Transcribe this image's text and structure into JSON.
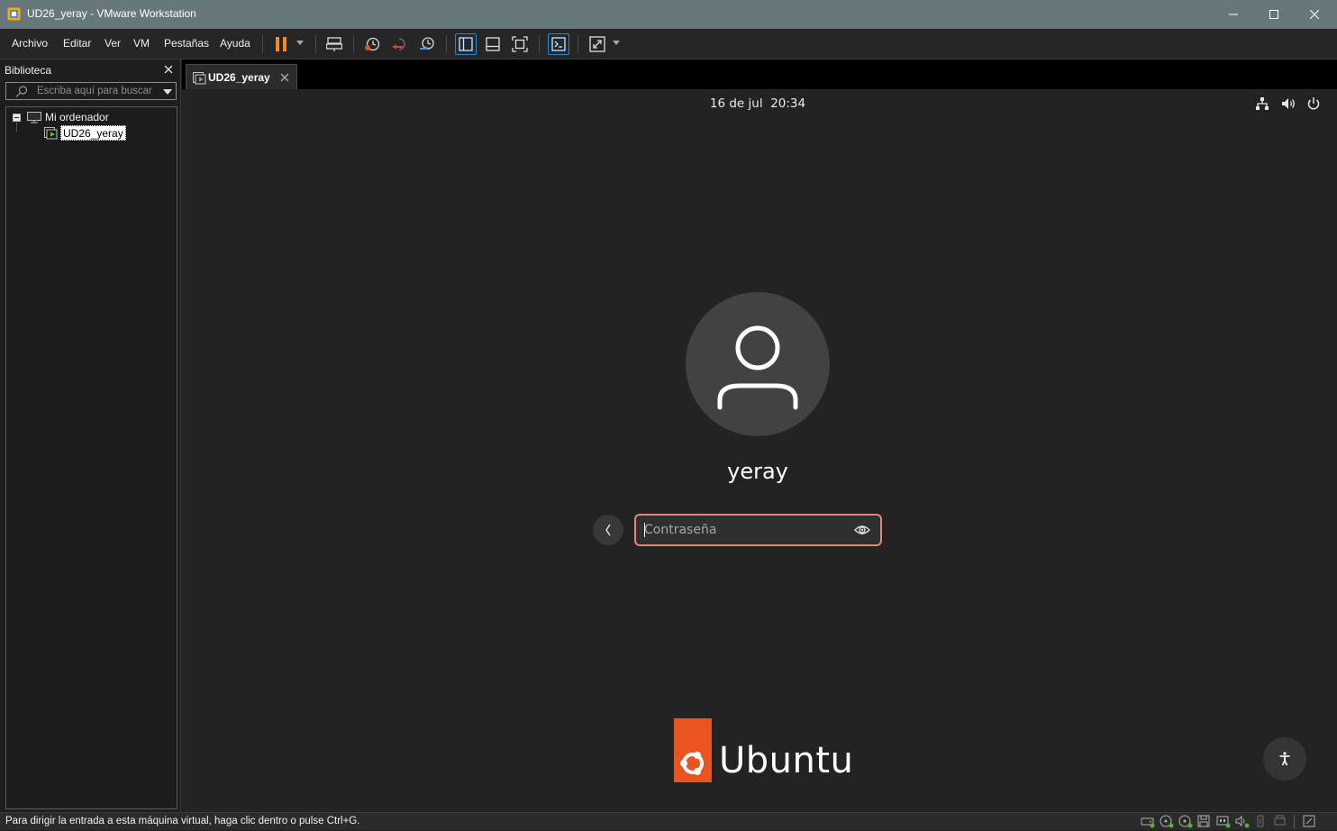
{
  "window": {
    "title": "UD26_yeray - VMware Workstation",
    "accent": "#67787a"
  },
  "menu": {
    "items": [
      "Archivo",
      "Editar",
      "Ver",
      "VM",
      "Pestañas",
      "Ayuda"
    ]
  },
  "library": {
    "title": "Biblioteca",
    "search_placeholder": "Escriba aquí para buscar",
    "tree": {
      "root_label": "Mi ordenador",
      "vm_label": "UD26_yeray"
    }
  },
  "tab": {
    "label": "UD26_yeray"
  },
  "gdm": {
    "date": "16 de jul",
    "time": "20:34",
    "username": "yeray",
    "password_placeholder": "Contraseña",
    "brand_word": "Ubuntu",
    "brand_color": "#e95420",
    "field_focus_color": "#e08870"
  },
  "status": {
    "text": "Para dirigir la entrada a esta máquina virtual, haga clic dentro o pulse Ctrl+G."
  }
}
